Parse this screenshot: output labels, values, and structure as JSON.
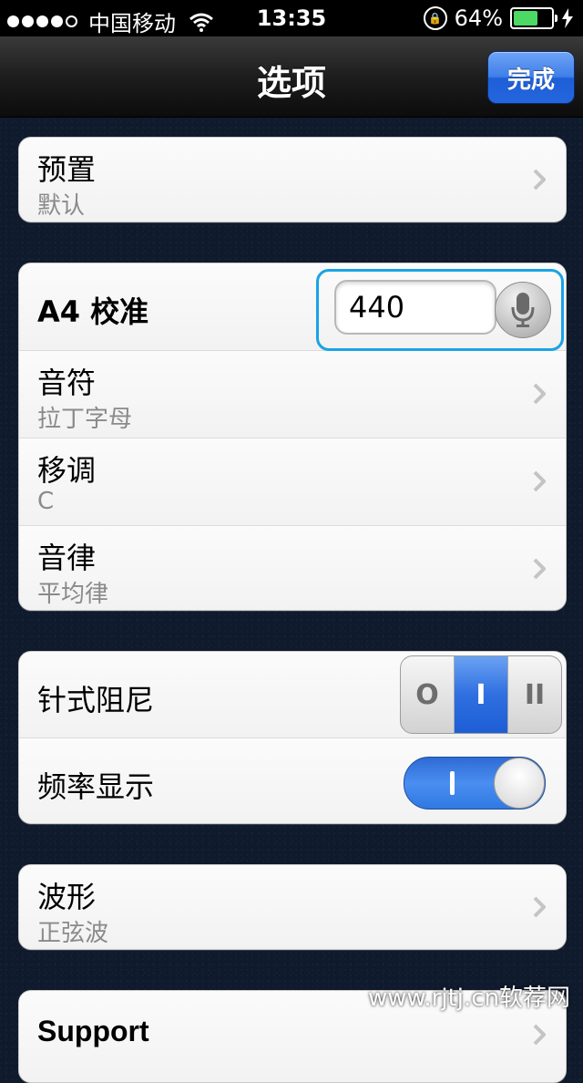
{
  "status": {
    "carrier": "中国移动",
    "time": "13:35",
    "battery_text": "64%",
    "battery_level": 0.64
  },
  "nav": {
    "title": "选项",
    "done_label": "完成"
  },
  "groups": {
    "preset": {
      "label": "预置",
      "value": "默认"
    },
    "tuning": {
      "a4_label": "A4 校准",
      "a4_value": "440",
      "note_label": "音符",
      "note_value": "拉丁字母",
      "transpose_label": "移调",
      "transpose_value": "C",
      "temperament_label": "音律",
      "temperament_value": "平均律"
    },
    "display": {
      "damping_label": "针式阻尼",
      "damping_options": [
        "O",
        "I",
        "II"
      ],
      "damping_selected": "I",
      "freq_label": "频率显示",
      "freq_enabled": true
    },
    "wave": {
      "label": "波形",
      "value": "正弦波"
    },
    "support": {
      "label": "Support"
    }
  },
  "watermark": "www.rjtj.cn软荐网",
  "colors": {
    "accent_blue": "#2f6fe0",
    "highlight": "#1aa3e6"
  }
}
